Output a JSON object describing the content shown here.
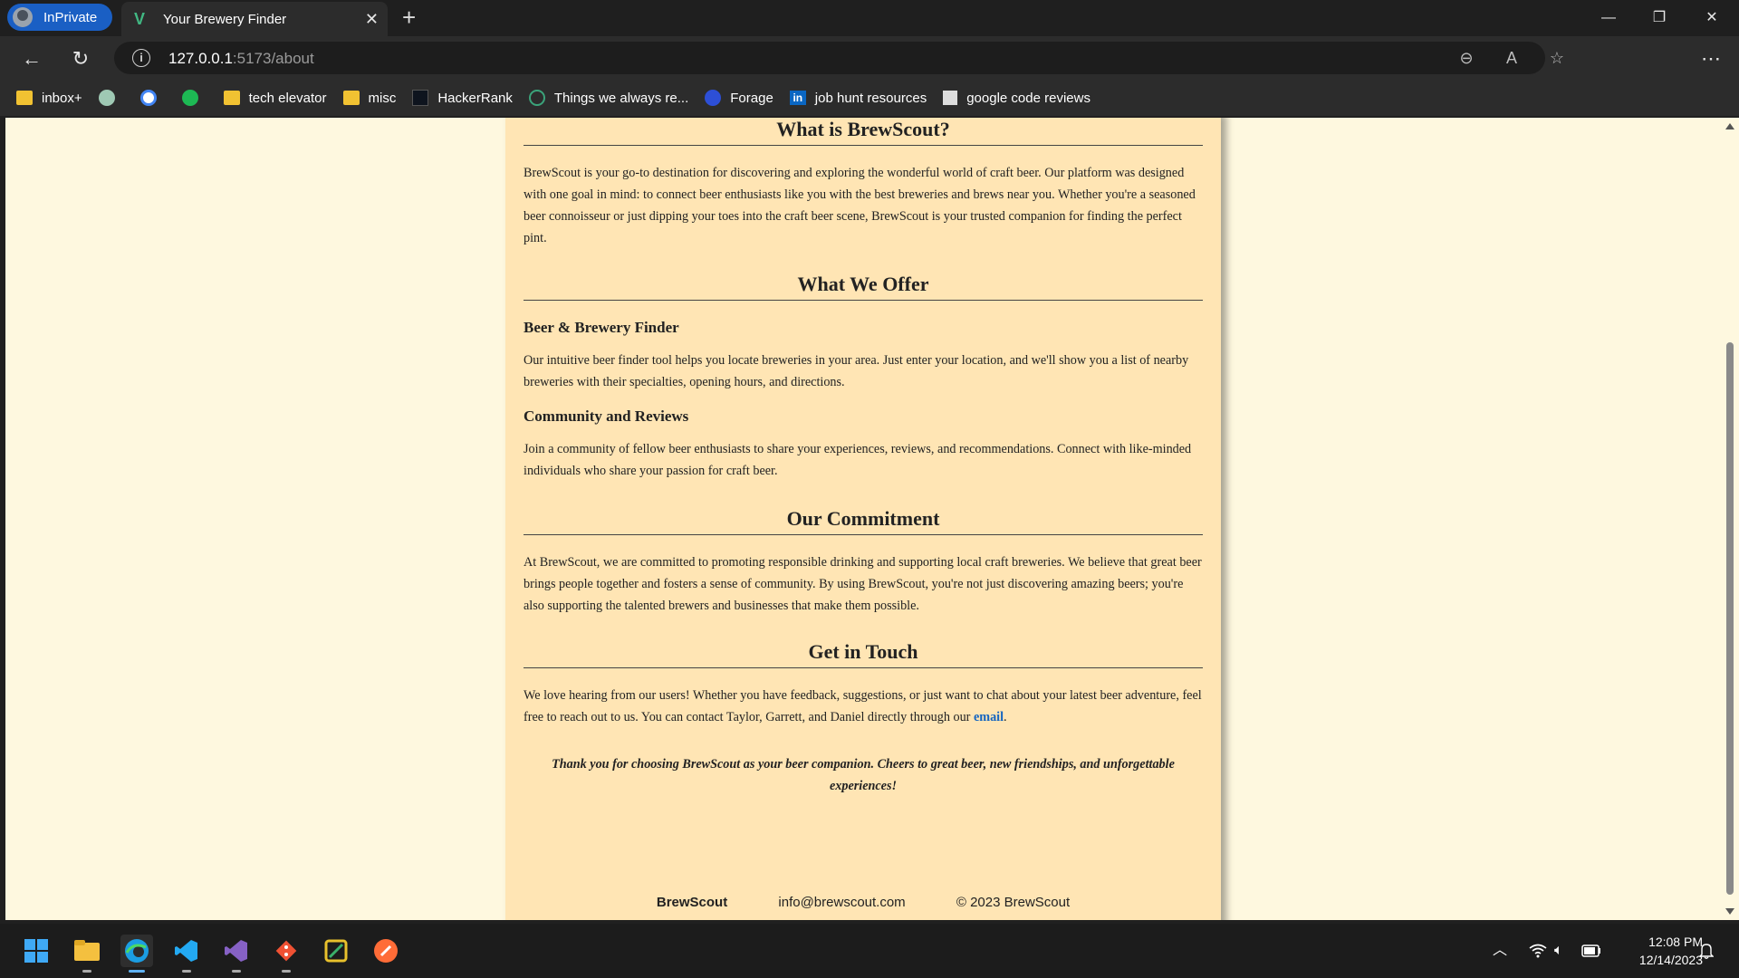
{
  "browser": {
    "inprivate_label": "InPrivate",
    "tab_title": "Your Brewery Finder",
    "url_host": "127.0.0.1",
    "url_rest": ":5173/about",
    "window_controls": [
      "minimize-icon",
      "restore-icon",
      "close-icon"
    ]
  },
  "bookmarks": [
    {
      "label": "inbox+",
      "icon": "folder-icon"
    },
    {
      "label": "",
      "icon": "chatgpt-icon"
    },
    {
      "label": "",
      "icon": "google-icon"
    },
    {
      "label": "",
      "icon": "spotify-icon"
    },
    {
      "label": "tech elevator",
      "icon": "folder-icon"
    },
    {
      "label": "misc",
      "icon": "folder-icon"
    },
    {
      "label": "HackerRank",
      "icon": "hackerrank-icon"
    },
    {
      "label": "Things we always re...",
      "icon": "page-icon"
    },
    {
      "label": "Forage",
      "icon": "forage-icon"
    },
    {
      "label": "job hunt resources",
      "icon": "linkedin-icon"
    },
    {
      "label": "google code reviews",
      "icon": "page-icon"
    }
  ],
  "about": {
    "s1_title": "What is BrewScout?",
    "s1_text": "BrewScout is your go-to destination for discovering and exploring the wonderful world of craft beer. Our platform was designed with one goal in mind: to connect beer enthusiasts like you with the best breweries and brews near you. Whether you're a seasoned beer connoisseur or just dipping your toes into the craft beer scene, BrewScout is your trusted companion for finding the perfect pint.",
    "s2_title": "What We Offer",
    "s2_sub1": "Beer & Brewery Finder",
    "s2_text1": "Our intuitive beer finder tool helps you locate breweries in your area. Just enter your location, and we'll show you a list of nearby breweries with their specialties, opening hours, and directions.",
    "s2_sub2": "Community and Reviews",
    "s2_text2": "Join a community of fellow beer enthusiasts to share your experiences, reviews, and recommendations. Connect with like-minded individuals who share your passion for craft beer.",
    "s3_title": "Our Commitment",
    "s3_text": "At BrewScout, we are committed to promoting responsible drinking and supporting local craft breweries. We believe that great beer brings people together and fosters a sense of community. By using BrewScout, you're not just discovering amazing beers; you're also supporting the talented brewers and businesses that make them possible.",
    "s4_title": "Get in Touch",
    "s4_text": "We love hearing from our users! Whether you have feedback, suggestions, or just want to chat about your latest beer adventure, feel free to reach out to us. You can contact Taylor, Garrett, and Daniel directly through our",
    "s4_link": "email",
    "s4_end": ".",
    "thanks": "Thank you for choosing BrewScout as your beer companion. Cheers to great beer, new friendships, and unforgettable experiences!"
  },
  "footer": {
    "brand": "BrewScout",
    "email": "info@brewscout.com",
    "copyright": "© 2023 BrewScout"
  },
  "taskbar": {
    "apps": [
      "windows-start-icon",
      "file-explorer-icon",
      "edge-icon",
      "vscode-icon",
      "visual-studio-icon",
      "git-icon",
      "snipping-tool-icon",
      "postman-icon"
    ],
    "time": "12:08 PM",
    "date": "12/14/2023"
  }
}
